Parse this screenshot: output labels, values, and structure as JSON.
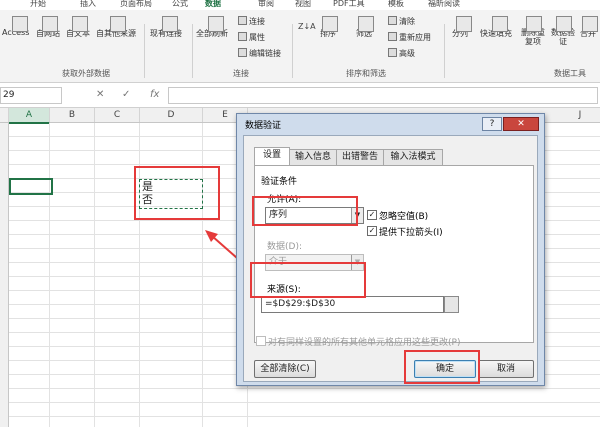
{
  "ribbon": {
    "tabs": [
      "开始",
      "插入",
      "页面布局",
      "公式",
      "数据",
      "审阅",
      "视图",
      "PDF工具",
      "模板",
      "福昕阅读"
    ],
    "active_tab": "数据",
    "buttons": {
      "access": "Access",
      "web": "自网站",
      "text": "自文本",
      "other": "自其他来源",
      "existing": "现有连接",
      "refresh_all": "全部刷新",
      "connections": "连接",
      "properties": "属性",
      "edit_links": "编辑链接",
      "sort_za": "Z↓A",
      "sort": "排序",
      "filter": "筛选",
      "clear": "清除",
      "reapply": "重新应用",
      "advanced": "高级",
      "split": "分列",
      "flash_fill": "快速填充",
      "remove_dup": "删除重复项",
      "validation": "数据验证",
      "consolidate": "合并"
    },
    "groups": {
      "get_external": "获取外部数据",
      "connections": "连接",
      "sort_filter": "排序和筛选",
      "data_tools": "数据工具"
    }
  },
  "formula_bar": {
    "name_box": "29",
    "cancel": "✕",
    "confirm": "✓",
    "fx": "fx",
    "value": ""
  },
  "grid": {
    "columns": [
      "A",
      "B",
      "C",
      "D",
      "E",
      "J"
    ],
    "cells": {
      "d29": "是",
      "d30": "否"
    }
  },
  "dialog": {
    "title": "数据验证",
    "help": "?",
    "close": "✕",
    "tabs": [
      "设置",
      "输入信息",
      "出错警告",
      "输入法模式"
    ],
    "active_tab": "设置",
    "section_label": "验证条件",
    "allow_label": "允许(A):",
    "allow_value": "序列",
    "ignore_blank_label": "忽略空值(B)",
    "ignore_blank_checked": true,
    "dropdown_label": "提供下拉箭头(I)",
    "dropdown_checked": true,
    "data_label": "数据(D):",
    "data_value": "介于",
    "source_label": "来源(S):",
    "source_value": "=$D$29:$D$30",
    "apply_all_label": "对有同样设置的所有其他单元格应用这些更改(P)",
    "apply_all_checked": false,
    "clear_all": "全部清除(C)",
    "ok": "确定",
    "cancel": "取消"
  },
  "colors": {
    "accent": "#217346",
    "annotation": "#e53a3a",
    "dialog_frame": "#cfdcec"
  }
}
